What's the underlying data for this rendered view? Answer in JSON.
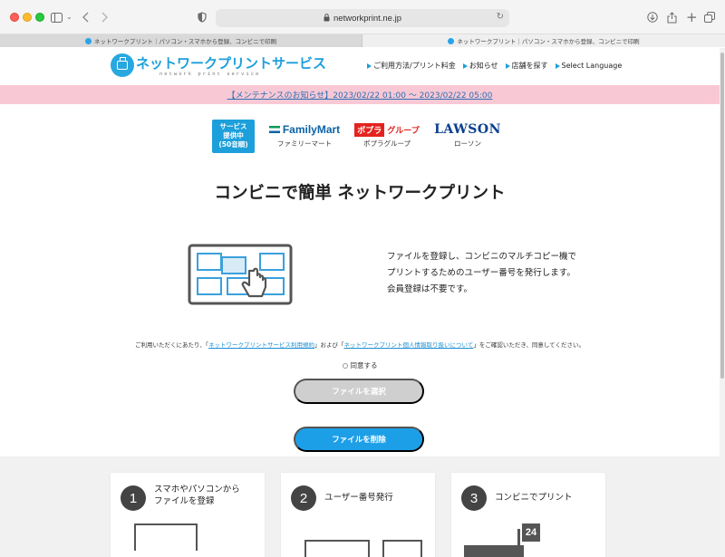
{
  "browser": {
    "url": "networkprint.ne.jp",
    "tabs": [
      {
        "label": "ネットワークプリント｜パソコン・スマホから登録、コンビニで印刷"
      },
      {
        "label": "ネットワークプリント｜パソコン・スマホから登録、コンビニで印刷"
      }
    ]
  },
  "header": {
    "logo_text": "ネットワークプリントサービス",
    "logo_subtext": "network print service",
    "nav": [
      {
        "label": "ご利用方法/プリント料金"
      },
      {
        "label": "お知らせ"
      },
      {
        "label": "店舗を探す"
      },
      {
        "label": "Select Language"
      }
    ]
  },
  "notice": {
    "text": "【メンテナンスのお知らせ】2023/02/22 01:00 ～ 2023/02/22 05:00"
  },
  "stores": {
    "badge_lines": [
      "サービス",
      "提供中",
      "(50音順)"
    ],
    "items": [
      {
        "logo": "FamilyMart",
        "caption": "ファミリーマート"
      },
      {
        "logo_box": "ポプラ",
        "logo": "グループ",
        "caption": "ポプラグループ"
      },
      {
        "logo": "LAWSON",
        "caption": "ローソン"
      }
    ]
  },
  "main": {
    "title": "コンビニで簡単 ネットワークプリント",
    "description_lines": [
      "ファイルを登録し、コンビニのマルチコピー機で",
      "プリントするためのユーザー番号を発行します。",
      "会員登録は不要です。"
    ]
  },
  "terms": {
    "prefix": "ご利用いただくにあたり、「",
    "link1": "ネットワークプリントサービス利用規約",
    "middle": "」および「",
    "link2": "ネットワークプリント個人情報取り扱いについて",
    "suffix": "」をご確認いただき、同意してください。",
    "agree_label": "同意する"
  },
  "buttons": {
    "select_file": "ファイルを選択",
    "delete_file": "ファイルを削除"
  },
  "steps": [
    {
      "number": "1",
      "lines": [
        "スマホやパソコンから",
        "ファイルを登録"
      ]
    },
    {
      "number": "2",
      "lines": [
        "ユーザー番号発行"
      ]
    },
    {
      "number": "3",
      "lines": [
        "コンビニでプリント"
      ]
    }
  ],
  "step3_badge": "24",
  "colors": {
    "brand_blue": "#1d9fdb",
    "notice_bg": "#f9c8d5",
    "button_active": "#1d9fe8",
    "button_disabled": "#cfcfcf"
  }
}
